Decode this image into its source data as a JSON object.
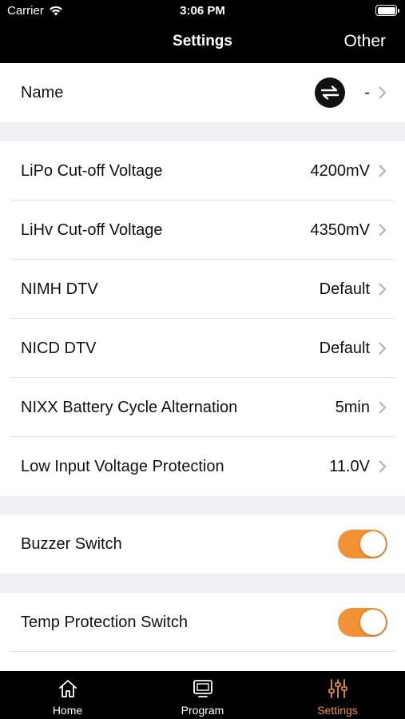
{
  "status_bar": {
    "carrier": "Carrier",
    "time": "3:06 PM"
  },
  "nav": {
    "title": "Settings",
    "right_button": "Other"
  },
  "name_row": {
    "label": "Name",
    "value": "-",
    "icon": "swap-arrows-icon"
  },
  "voltage_settings": [
    {
      "label": " LiPo Cut-off Voltage",
      "value": "4200mV"
    },
    {
      "label": "LiHv Cut-off Voltage",
      "value": "4350mV"
    },
    {
      "label": "NIMH DTV",
      "value": "Default"
    },
    {
      "label": "NICD DTV",
      "value": "Default"
    },
    {
      "label": "NIXX Battery Cycle Alternation",
      "value": "5min"
    },
    {
      "label": "Low Input Voltage Protection",
      "value": "11.0V"
    }
  ],
  "switches": [
    {
      "label": "Buzzer Switch",
      "on": true
    },
    {
      "label": "Temp Protection Switch",
      "on": true
    }
  ],
  "tabs": [
    {
      "label": "Home",
      "icon": "home-icon",
      "active": false
    },
    {
      "label": "Program",
      "icon": "monitor-icon",
      "active": false
    },
    {
      "label": "Settings",
      "icon": "sliders-icon",
      "active": true
    }
  ],
  "colors": {
    "accent": "#f39135",
    "bar": "#000000",
    "background": "#efeff4"
  }
}
